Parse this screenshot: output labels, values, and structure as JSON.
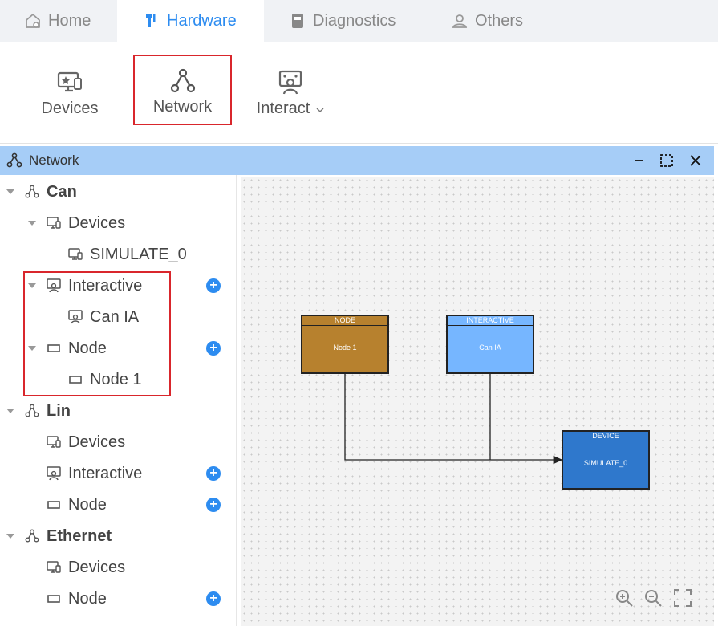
{
  "tabs": [
    {
      "label": "Home",
      "icon": "home-gear-icon"
    },
    {
      "label": "Hardware",
      "icon": "hardware-icon",
      "active": true
    },
    {
      "label": "Diagnostics",
      "icon": "book-icon"
    },
    {
      "label": "Others",
      "icon": "user-icon"
    }
  ],
  "ribbon": {
    "devices": "Devices",
    "network": "Network",
    "interact": "Interact"
  },
  "panel": {
    "title": "Network"
  },
  "tree": {
    "can": "Can",
    "can_devices": "Devices",
    "can_simulate": "SIMULATE_0",
    "can_interactive": "Interactive",
    "can_ia": "Can IA",
    "can_node": "Node",
    "can_node1": "Node 1",
    "lin": "Lin",
    "lin_devices": "Devices",
    "lin_interactive": "Interactive",
    "lin_node": "Node",
    "ethernet": "Ethernet",
    "eth_devices": "Devices",
    "eth_node": "Node"
  },
  "graph": {
    "node": {
      "header": "NODE",
      "label": "Node 1",
      "color": "#b7812e"
    },
    "interactive": {
      "header": "INTERACTIVE",
      "label": "Can IA",
      "color": "#76b6ff"
    },
    "device": {
      "header": "DEVICE",
      "label": "SIMULATE_0",
      "color": "#2f78cc"
    }
  },
  "colors": {
    "accent": "#2d8cf0",
    "panel_header": "#a6cdf7",
    "highlight": "#d9262c"
  }
}
